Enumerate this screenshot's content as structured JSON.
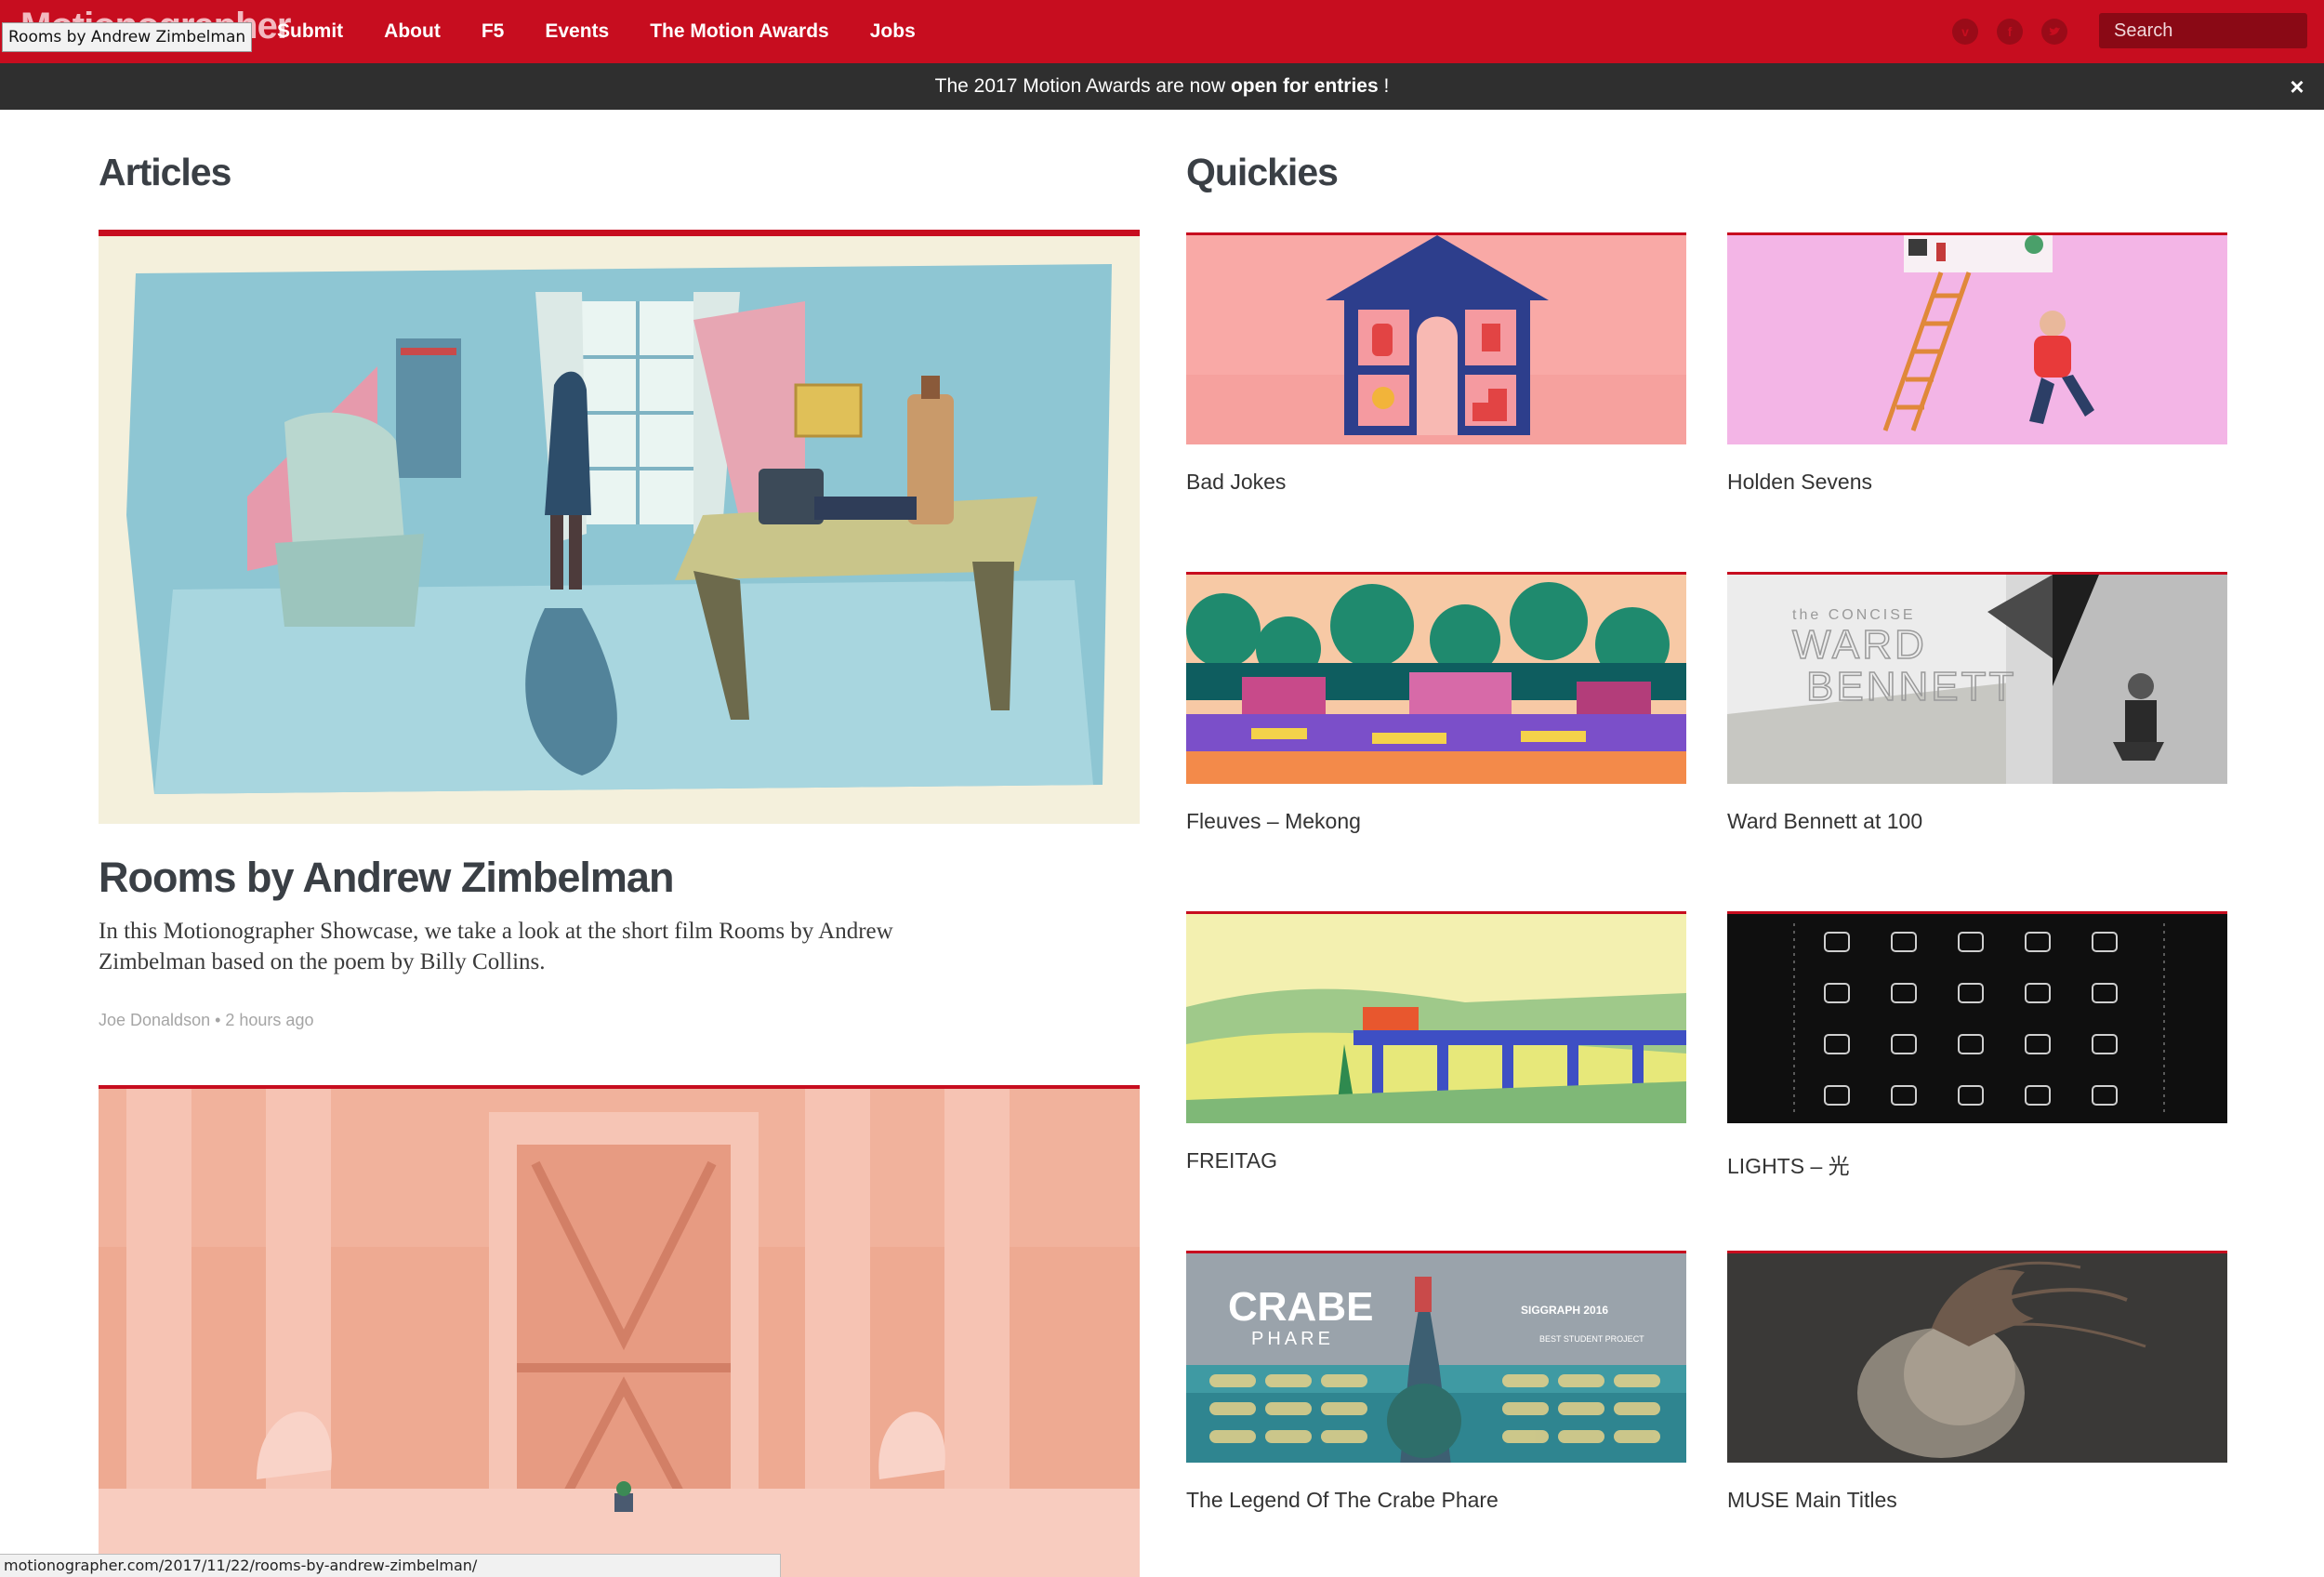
{
  "nav": {
    "logo": "Motionographer",
    "tooltip": "Rooms by Andrew Zimbelman",
    "links": [
      "Submit",
      "About",
      "F5",
      "Events",
      "The Motion Awards",
      "Jobs"
    ],
    "social_icons": [
      "vimeo-icon",
      "facebook-icon",
      "twitter-icon"
    ],
    "search_placeholder": "Search"
  },
  "announcement": {
    "prefix": "The 2017 Motion Awards are now ",
    "link": "open for entries",
    "suffix": " !",
    "close": "×"
  },
  "articles": {
    "heading": "Articles",
    "featured": {
      "title": "Rooms by Andrew Zimbelman",
      "excerpt": "In this Motionographer Showcase, we take a look at the short film Rooms by Andrew Zimbelman based on the poem by Billy Collins.",
      "meta": "Joe Donaldson • 2 hours ago"
    }
  },
  "quickies": {
    "heading": "Quickies",
    "items": [
      {
        "label": "Bad Jokes"
      },
      {
        "label": "Holden Sevens"
      },
      {
        "label": "Fleuves – Mekong"
      },
      {
        "label": "Ward Bennett at 100",
        "thumb_text_1": "the CONCISE",
        "thumb_text_2": "WARD",
        "thumb_text_3": "BENNETT"
      },
      {
        "label": "FREITAG"
      },
      {
        "label": "LIGHTS – 光"
      },
      {
        "label": "The Legend Of The Crabe Phare",
        "thumb_text_1": "CRABE",
        "thumb_text_2": "PHARE",
        "thumb_text_3": "SIGGRAPH 2016",
        "thumb_text_4": "BEST STUDENT PROJECT"
      },
      {
        "label": "MUSE Main Titles"
      }
    ]
  },
  "status_url": "motionographer.com/2017/11/22/rooms-by-andrew-zimbelman/",
  "colors": {
    "brand_red": "#c70d1f",
    "announce_bg": "#2f2f2f",
    "heading": "#3a3f45"
  }
}
